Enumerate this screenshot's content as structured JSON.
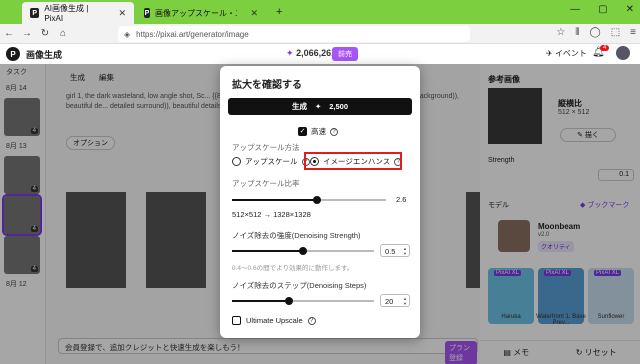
{
  "browser": {
    "tabs": [
      {
        "label": "AI画像生成 | PixAI",
        "favicon": "P"
      },
      {
        "label": "画像アップスケール・エンハンス | Pix",
        "favicon": "P"
      }
    ],
    "window_controls": [
      "—",
      "▢",
      "✕"
    ],
    "url": "https://pixai.art/generator/image"
  },
  "header": {
    "title": "画像生成",
    "credits": "2,066,261",
    "charge_label": "前売",
    "events_label": "イベント",
    "notification_count": "4"
  },
  "tasks": {
    "title": "タスク",
    "groups": [
      {
        "date": "8月 14",
        "count": "4"
      },
      {
        "date": "8月 13",
        "count": "4"
      },
      {
        "date": "",
        "count": "4"
      },
      {
        "date": "",
        "count": "4"
      },
      {
        "date": "8月 12",
        "count": ""
      }
    ]
  },
  "main": {
    "tabs": [
      "生成",
      "編集"
    ],
    "prompt": "girl 1, the dark wasteland, low angle shot, Sc... {{8k_wallpaper}}, illustration, overexposure, ... ((beautiful detailed background)), beautiful de... detailed surround)), beautiful details in the s...",
    "option_label": "オプション",
    "input_placeholder": "会員登録で、追加クレジットと快速生成を楽しもう！",
    "signup_label": "プラン登録"
  },
  "modal": {
    "title": "拡大を確認する",
    "generate_label": "生成",
    "generate_cost": "2,500",
    "hq_label": "高速",
    "method_label": "アップスケール方法",
    "option_upscale": "アップスケール",
    "option_enhance": "イメージエンハンス",
    "ratio_label": "アップスケール比率",
    "ratio_value": "2.6",
    "resolution": "512×512 → 1328×1328",
    "denoise_strength_label": "ノイズ除去の強度(Denoising Strength)",
    "denoise_strength_value": "0.5",
    "denoise_hint": "0.4〜0.6の間でより効果的に動作します。",
    "denoise_steps_label": "ノイズ除去のステップ(Denoising Steps)",
    "denoise_steps_value": "20",
    "ultimate_label": "Ultimate Upscale",
    "ratio_level": 0.55,
    "strength_level": 0.5,
    "steps_level": 0.4
  },
  "right": {
    "ref_title": "参考画像",
    "ref_kind": "縦横比",
    "ref_size": "512 × 512",
    "draw_label": "描く",
    "strength_label": "Strength",
    "strength_value": "0.1",
    "model_label": "モデル",
    "bookmark_label": "ブックマーク",
    "model_name": "Moonbeam",
    "model_version": "v2.0",
    "quality_label": "クオリティ",
    "cards": [
      {
        "tag": "PixAI XL",
        "name": "Haruka"
      },
      {
        "tag": "PixAI XL",
        "name": "Waterfront 1. Base Prev..."
      },
      {
        "tag": "PixAI XL",
        "name": "Sunflower"
      }
    ],
    "memo_label": "メモ",
    "reset_label": "リセット"
  }
}
